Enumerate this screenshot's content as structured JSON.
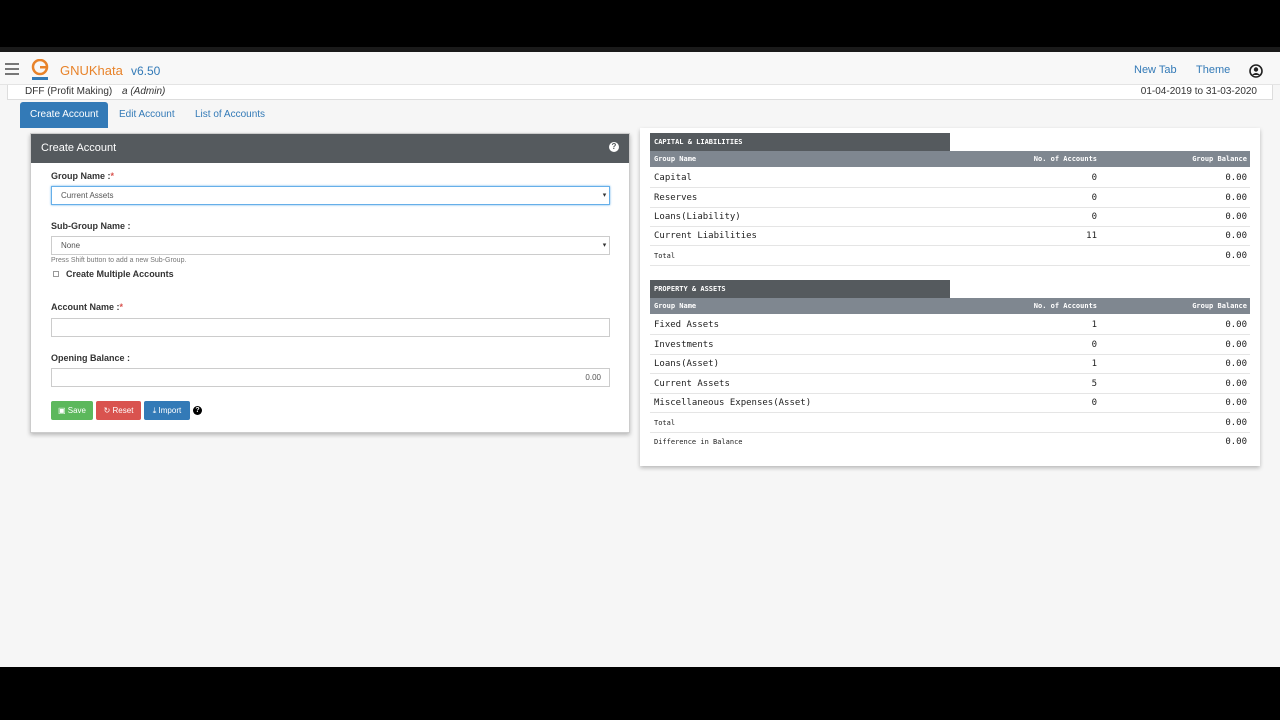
{
  "app": {
    "brand": "GNUKhata",
    "version": "v6.50"
  },
  "nav": {
    "new_tab": "New Tab",
    "theme": "Theme"
  },
  "info": {
    "org": "DFF (Profit Making)",
    "role": "a (Admin)",
    "fy": "01-04-2019 to 31-03-2020"
  },
  "tabs": [
    "Create Account",
    "Edit Account",
    "List of Accounts"
  ],
  "form": {
    "title": "Create Account",
    "group_label": "Group Name :",
    "group_value": "Current Assets",
    "subgroup_label": "Sub-Group Name :",
    "subgroup_value": "None",
    "hint": "Press Shift button to add a new Sub-Group.",
    "multi_label": "Create Multiple Accounts",
    "account_label": "Account Name :",
    "account_value": "",
    "opening_label": "Opening Balance :",
    "opening_value": "0.00",
    "save": "Save",
    "reset": "Reset",
    "import": "Import",
    "required_mark": "*"
  },
  "liabilities": {
    "title": "CAPITAL & LIABILITIES",
    "headers": [
      "Group Name",
      "No. of Accounts",
      "Group Balance"
    ],
    "rows": [
      [
        "Capital",
        "0",
        "0.00"
      ],
      [
        "Reserves",
        "0",
        "0.00"
      ],
      [
        "Loans(Liability)",
        "0",
        "0.00"
      ],
      [
        "Current Liabilities",
        "11",
        "0.00"
      ],
      [
        "Total",
        "",
        "0.00"
      ]
    ]
  },
  "assets": {
    "title": "PROPERTY & ASSETS",
    "headers": [
      "Group Name",
      "No. of Accounts",
      "Group Balance"
    ],
    "rows": [
      [
        "Fixed Assets",
        "1",
        "0.00"
      ],
      [
        "Investments",
        "0",
        "0.00"
      ],
      [
        "Loans(Asset)",
        "1",
        "0.00"
      ],
      [
        "Current Assets",
        "5",
        "0.00"
      ],
      [
        "Miscellaneous Expenses(Asset)",
        "0",
        "0.00"
      ],
      [
        "Total",
        "",
        "0.00"
      ],
      [
        "Difference in Balance",
        "",
        "0.00"
      ]
    ]
  }
}
